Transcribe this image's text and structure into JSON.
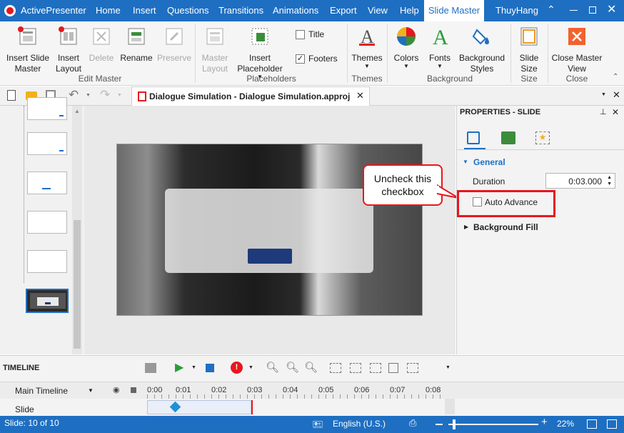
{
  "app": {
    "name": "ActivePresenter",
    "user": "ThuyHang"
  },
  "menu_tabs": [
    "Home",
    "Insert",
    "Questions",
    "Transitions",
    "Animations",
    "Export",
    "View",
    "Help",
    "Slide Master"
  ],
  "ribbon": {
    "insert_slide_master": "Insert Slide Master",
    "insert_layout": "Insert Layout",
    "delete": "Delete",
    "rename": "Rename",
    "preserve": "Preserve",
    "master_layout": "Master Layout",
    "insert_placeholder": "Insert Placeholder",
    "title_checkbox": "Title",
    "footers_checkbox": "Footers",
    "themes": "Themes",
    "colors": "Colors",
    "fonts": "Fonts",
    "background_styles": "Background Styles",
    "slide_size": "Slide Size",
    "close_master_view": "Close Master View",
    "groups": {
      "edit_master": "Edit Master",
      "placeholders": "Placeholders",
      "themes": "Themes",
      "background": "Background",
      "size": "Size",
      "close": "Close"
    },
    "footers_checked": true,
    "title_checked": false
  },
  "document_tab": {
    "title": "Dialogue Simulation - Dialogue Simulation.approj"
  },
  "callout": {
    "text": "Uncheck this checkbox"
  },
  "properties": {
    "header": "PROPERTIES - SLIDE",
    "general": "General",
    "duration_label": "Duration",
    "duration_value": "0:03.000",
    "auto_advance": "Auto Advance",
    "auto_advance_checked": false,
    "background_fill": "Background Fill"
  },
  "timeline": {
    "title": "TIMELINE",
    "main_timeline": "Main Timeline",
    "row_slide": "Slide",
    "ticks": [
      "0:00",
      "0:01",
      "0:02",
      "0:03",
      "0:04",
      "0:05",
      "0:06",
      "0:07",
      "0:08"
    ]
  },
  "status": {
    "slide_info": "Slide: 10 of 10",
    "language": "English (U.S.)",
    "zoom": "22%"
  },
  "colors": {
    "accent": "#1e6fc2",
    "highlight": "#e8171d"
  }
}
